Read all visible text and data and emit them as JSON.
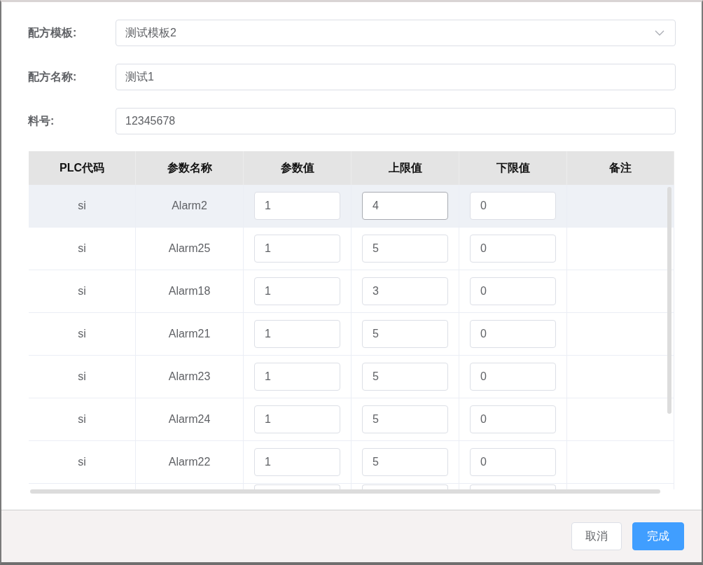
{
  "form": [
    {
      "kind": "select",
      "label": "配方模板:",
      "value": "测试模板2"
    },
    {
      "kind": "text",
      "label": "配方名称:",
      "value": "测试1"
    },
    {
      "kind": "text",
      "label": "料号:",
      "value": "12345678"
    }
  ],
  "table": {
    "columns": [
      "PLC代码",
      "参数名称",
      "参数值",
      "上限值",
      "下限值",
      "备注"
    ],
    "rows": [
      {
        "plc": "si",
        "name": "Alarm2",
        "value": "1",
        "upper": "4",
        "lower": "0",
        "highlighted": true,
        "upper_focused": true
      },
      {
        "plc": "si",
        "name": "Alarm25",
        "value": "1",
        "upper": "5",
        "lower": "0",
        "highlighted": false,
        "upper_focused": false
      },
      {
        "plc": "si",
        "name": "Alarm18",
        "value": "1",
        "upper": "3",
        "lower": "0",
        "highlighted": false,
        "upper_focused": false
      },
      {
        "plc": "si",
        "name": "Alarm21",
        "value": "1",
        "upper": "5",
        "lower": "0",
        "highlighted": false,
        "upper_focused": false
      },
      {
        "plc": "si",
        "name": "Alarm23",
        "value": "1",
        "upper": "5",
        "lower": "0",
        "highlighted": false,
        "upper_focused": false
      },
      {
        "plc": "si",
        "name": "Alarm24",
        "value": "1",
        "upper": "5",
        "lower": "0",
        "highlighted": false,
        "upper_focused": false
      },
      {
        "plc": "si",
        "name": "Alarm22",
        "value": "1",
        "upper": "5",
        "lower": "0",
        "highlighted": false,
        "upper_focused": false
      }
    ]
  },
  "buttons": [
    {
      "label": "取消",
      "kind": "default"
    },
    {
      "label": "完成",
      "kind": "primary"
    }
  ]
}
